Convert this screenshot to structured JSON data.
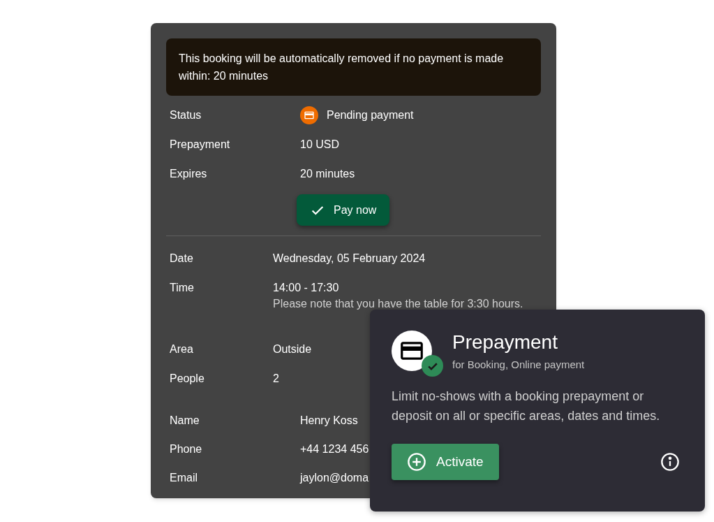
{
  "notice": "This booking will be automatically removed if no payment is made within: 20 minutes",
  "payment": {
    "rows": [
      {
        "label": "Status",
        "value": "Pending payment",
        "kind": "status"
      },
      {
        "label": "Prepayment",
        "value": "10 USD",
        "kind": "text"
      },
      {
        "label": "Expires",
        "value": "20 minutes",
        "kind": "text"
      }
    ],
    "pay_button": "Pay now"
  },
  "booking": [
    {
      "label": "Date",
      "value": "Wednesday, 05 February 2024"
    },
    {
      "label": "Time",
      "value": "14:00 - 17:30",
      "note": "Please note that you have the table for 3:30 hours."
    },
    {
      "label": "Area",
      "value": "Outside"
    },
    {
      "label": "People",
      "value": "2"
    }
  ],
  "guest": [
    {
      "label": "Name",
      "value": "Henry Koss"
    },
    {
      "label": "Phone",
      "value": "+44 1234 456"
    },
    {
      "label": "Email",
      "value": "jaylon@doma"
    }
  ],
  "feature_card": {
    "title": "Prepayment",
    "subtitle": "for Booking, Online payment",
    "description": "Limit no-shows with a booking prepayment or deposit on all or specific areas, dates and times.",
    "activate_button": "Activate"
  }
}
